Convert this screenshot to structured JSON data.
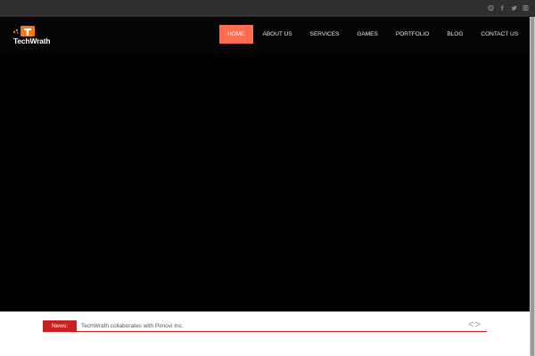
{
  "topbar": {
    "social_icons": [
      "skype-icon",
      "facebook-icon",
      "twitter-icon",
      "instagram-icon"
    ]
  },
  "header": {
    "logo_text": "TechWrath",
    "nav": [
      {
        "label": "HOME",
        "active": true
      },
      {
        "label": "ABOUT US",
        "active": false
      },
      {
        "label": "SERVICES",
        "active": false
      },
      {
        "label": "GAMES",
        "active": false
      },
      {
        "label": "PORTFOLIO",
        "active": false
      },
      {
        "label": "BLOG",
        "active": false
      },
      {
        "label": "CONTACT US",
        "active": false
      }
    ]
  },
  "news": {
    "label": "News:",
    "headline": "TechWrath collaborates with Pimovi Inc.",
    "prev_arrow": "<",
    "next_arrow": ">"
  },
  "colors": {
    "accent": "#ff6c4f",
    "news_red": "#cc1f1f",
    "topbar": "#2f2f2f"
  }
}
